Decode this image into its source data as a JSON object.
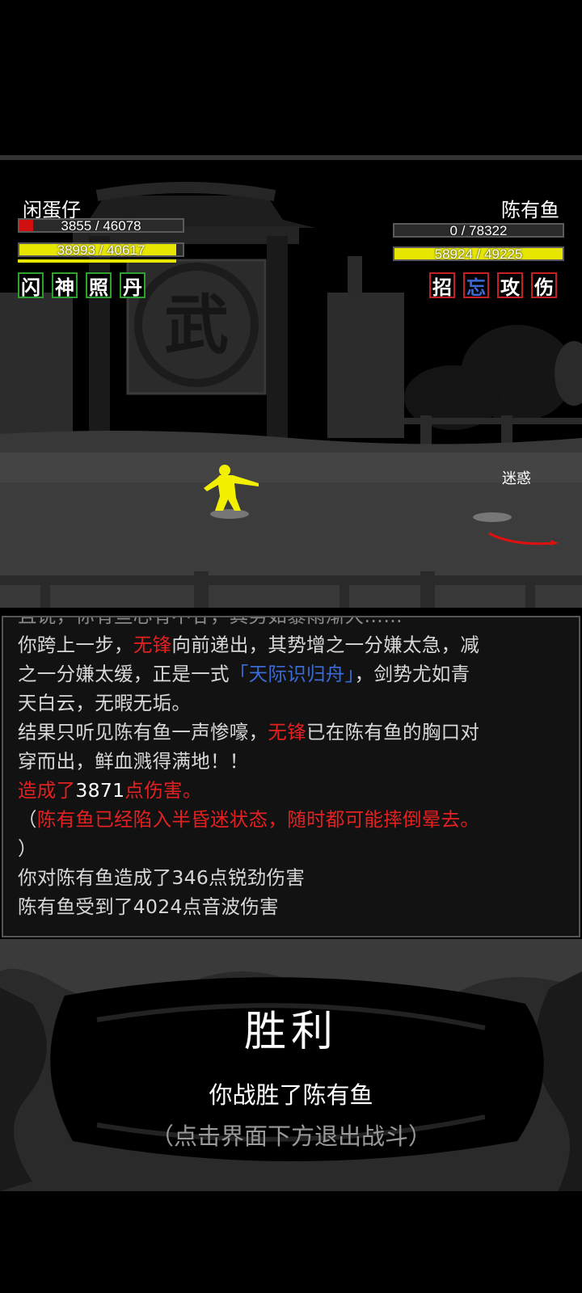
{
  "player": {
    "name": "闲蛋仔",
    "hp_text": "3855 / 46078",
    "hp_fraction": 0.084,
    "neili_text": "38993 / 40617",
    "neili_fraction": 0.96,
    "skills": [
      "闪",
      "神",
      "照",
      "丹"
    ],
    "colors": {
      "hp": "#d01010",
      "neili": "#e6e600",
      "skill_border": "#2fa12f"
    }
  },
  "enemy": {
    "name": "陈有鱼",
    "hp_text": "0 / 78322",
    "hp_fraction": 0.0,
    "neili_text": "58924 / 49225",
    "neili_fraction": 1.0,
    "skills": [
      "招",
      "忘",
      "攻",
      "伤"
    ],
    "status": "迷惑",
    "colors": {
      "neili": "#e6e600",
      "skill_border": "#c62020"
    }
  },
  "scene": {
    "banner_char": "武",
    "colors": {
      "fighter": "#f2f000",
      "blood": "#e01010"
    }
  },
  "log": {
    "line0": "且说，你有些心有不甘，其势如暴雨渐大……",
    "line1a": "你跨上一步，",
    "line1b": "无锋",
    "line1c": "向前递出，其势增之一分嫌太急，减",
    "line2a": "之一分嫌太缓，正是一式",
    "line2b": "「天际识归舟」",
    "line2c": "，剑势尤如青",
    "line3": "天白云，无暇无垢。",
    "line4a": "结果只听见陈有鱼一声惨嚎，",
    "line4b": "无锋",
    "line4c": "已在陈有鱼的胸口对",
    "line5": "穿而出，鲜血溅得满地！！",
    "line6a": "造成了",
    "line6b": "3871",
    "line6c": "点伤害。",
    "line7a": "（",
    "line7b": "陈有鱼已经陷入半昏迷状态，随时都可能摔倒晕去。",
    "line8": "）",
    "line9": "你对陈有鱼造成了346点锐劲伤害",
    "line10": "陈有鱼受到了4024点音波伤害"
  },
  "victory": {
    "title": "胜利",
    "subtitle": "你战胜了陈有鱼",
    "hint": "（点击界面下方退出战斗）"
  }
}
